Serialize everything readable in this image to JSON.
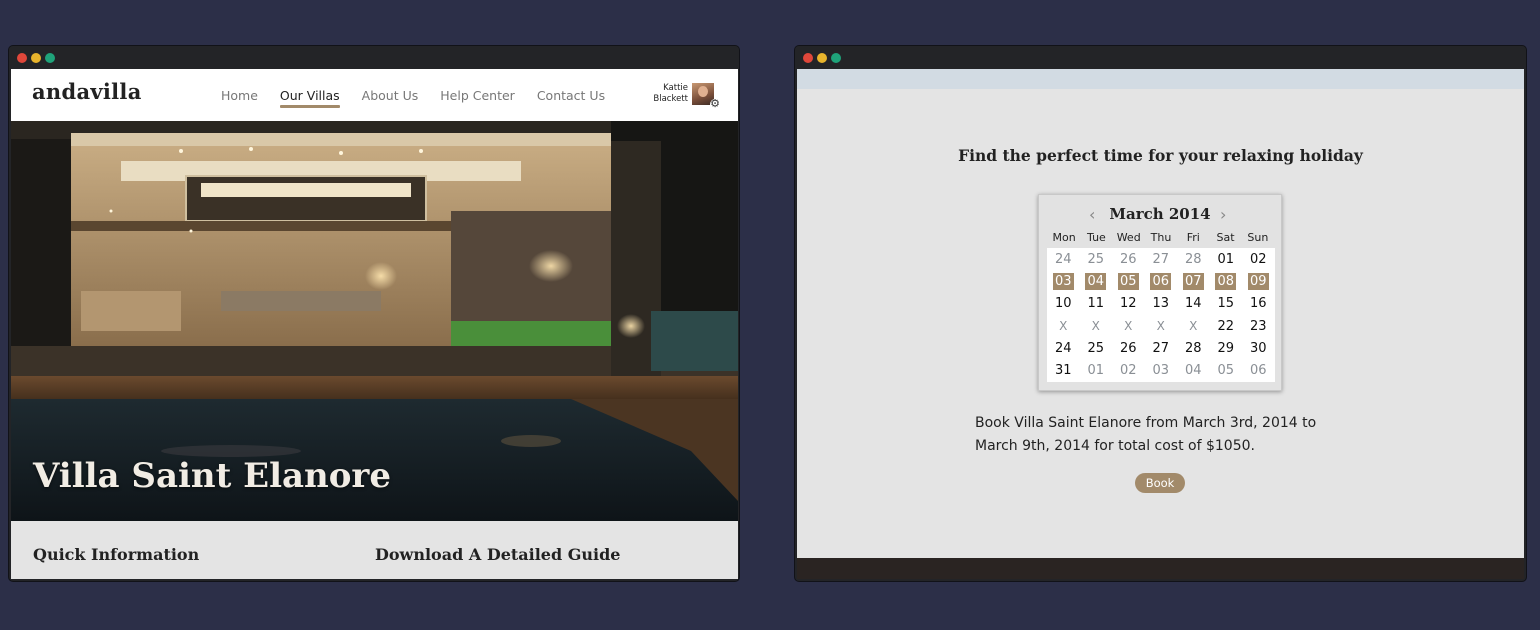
{
  "window1": {
    "logo": "andavilla",
    "nav": [
      "Home",
      "Our Villas",
      "About Us",
      "Help Center",
      "Contact Us"
    ],
    "active_nav": "Our Villas",
    "user": {
      "first": "Kattie",
      "last": "Blackett"
    },
    "hero_title": "Villa Saint Elanore",
    "sections": {
      "quick_info": "Quick Information",
      "guide": "Download A Detailed Guide"
    }
  },
  "window2": {
    "headline": "Find the perfect time for your relaxing holiday",
    "calendar": {
      "month": "March 2014",
      "weekdays": [
        "Mon",
        "Tue",
        "Wed",
        "Thu",
        "Fri",
        "Sat",
        "Sun"
      ],
      "weeks": [
        [
          "24",
          "25",
          "26",
          "27",
          "28",
          "01",
          "02"
        ],
        [
          "03",
          "04",
          "05",
          "06",
          "07",
          "08",
          "09"
        ],
        [
          "10",
          "11",
          "12",
          "13",
          "14",
          "15",
          "16"
        ],
        [
          "X",
          "X",
          "X",
          "X",
          "X",
          "22",
          "23"
        ],
        [
          "24",
          "25",
          "26",
          "27",
          "28",
          "29",
          "30"
        ],
        [
          "31",
          "01",
          "02",
          "03",
          "04",
          "05",
          "06"
        ]
      ]
    },
    "summary_line1": "Book Villa Saint Elanore from March 3rd, 2014 to",
    "summary_line2": "March 9th, 2014 for total cost of $1050.",
    "book_label": "Book"
  },
  "colors": {
    "accent": "#a28a6a",
    "background": "#2c2f48"
  }
}
